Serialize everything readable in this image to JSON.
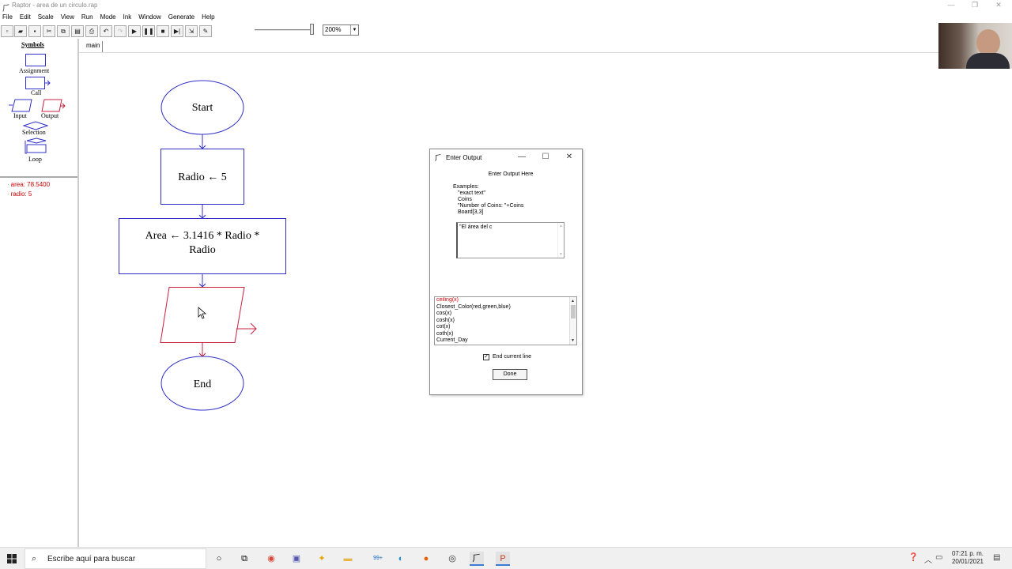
{
  "window": {
    "title": "Raptor - area de un circulo.rap",
    "controls": [
      "—",
      "❐",
      "✕"
    ]
  },
  "menu": [
    "File",
    "Edit",
    "Scale",
    "View",
    "Run",
    "Mode",
    "Ink",
    "Window",
    "Generate",
    "Help"
  ],
  "toolbar": {
    "zoom_value": "200%",
    "buttons": [
      "new",
      "open",
      "save",
      "cut",
      "copy",
      "paste",
      "print",
      "undo",
      "redo",
      "run",
      "pause",
      "stop",
      "step",
      "test",
      "pen"
    ]
  },
  "symbols": {
    "heading": "Symbols",
    "assignment": "Assignment",
    "call": "Call",
    "input": "Input",
    "output": "Output",
    "selection": "Selection",
    "loop": "Loop"
  },
  "variables": [
    "area: 78.5400",
    "radio: 5"
  ],
  "tabs": [
    "main"
  ],
  "flowchart": {
    "start": "Start",
    "assign1": "Radio ← 5",
    "assign2_line1": "Area ← 3.1416  *  Radio  *",
    "assign2_line2": "Radio",
    "end": "End",
    "colors": {
      "terminal": "#3030c8",
      "assignment": "#3030c8",
      "output": "#c8203c",
      "arrow": "#3030c8"
    }
  },
  "dialog": {
    "title": "Enter Output",
    "heading": "Enter Output Here",
    "examples_label": "Examples:",
    "examples": [
      "\"exact text\"",
      "Coins",
      "\"Number of Coins: \"+Coins",
      "Board[3,3]"
    ],
    "output_text": "\"El área del c",
    "functions": [
      "ceiling(x)",
      "Closest_Color(red,green,blue)",
      "cos(x)",
      "cosh(x)",
      "cot(x)",
      "coth(x)",
      "Current_Day"
    ],
    "selected_function": "ceiling(x)",
    "end_current_line_label": "End current line",
    "end_current_line_checked": true,
    "done_label": "Done"
  },
  "taskbar": {
    "search_placeholder": "Escribe aquí para buscar",
    "apps": [
      "task-view-icon",
      "chrome-icon",
      "teams-icon",
      "unknown-app-icon",
      "file-explorer-icon",
      "mail-icon",
      "edge-icon",
      "firefox-icon",
      "obs-icon",
      "raptor-icon",
      "powerpoint-icon"
    ],
    "mail_badge": "99+",
    "time": "07:21 p. m.",
    "date": "20/01/2021"
  }
}
